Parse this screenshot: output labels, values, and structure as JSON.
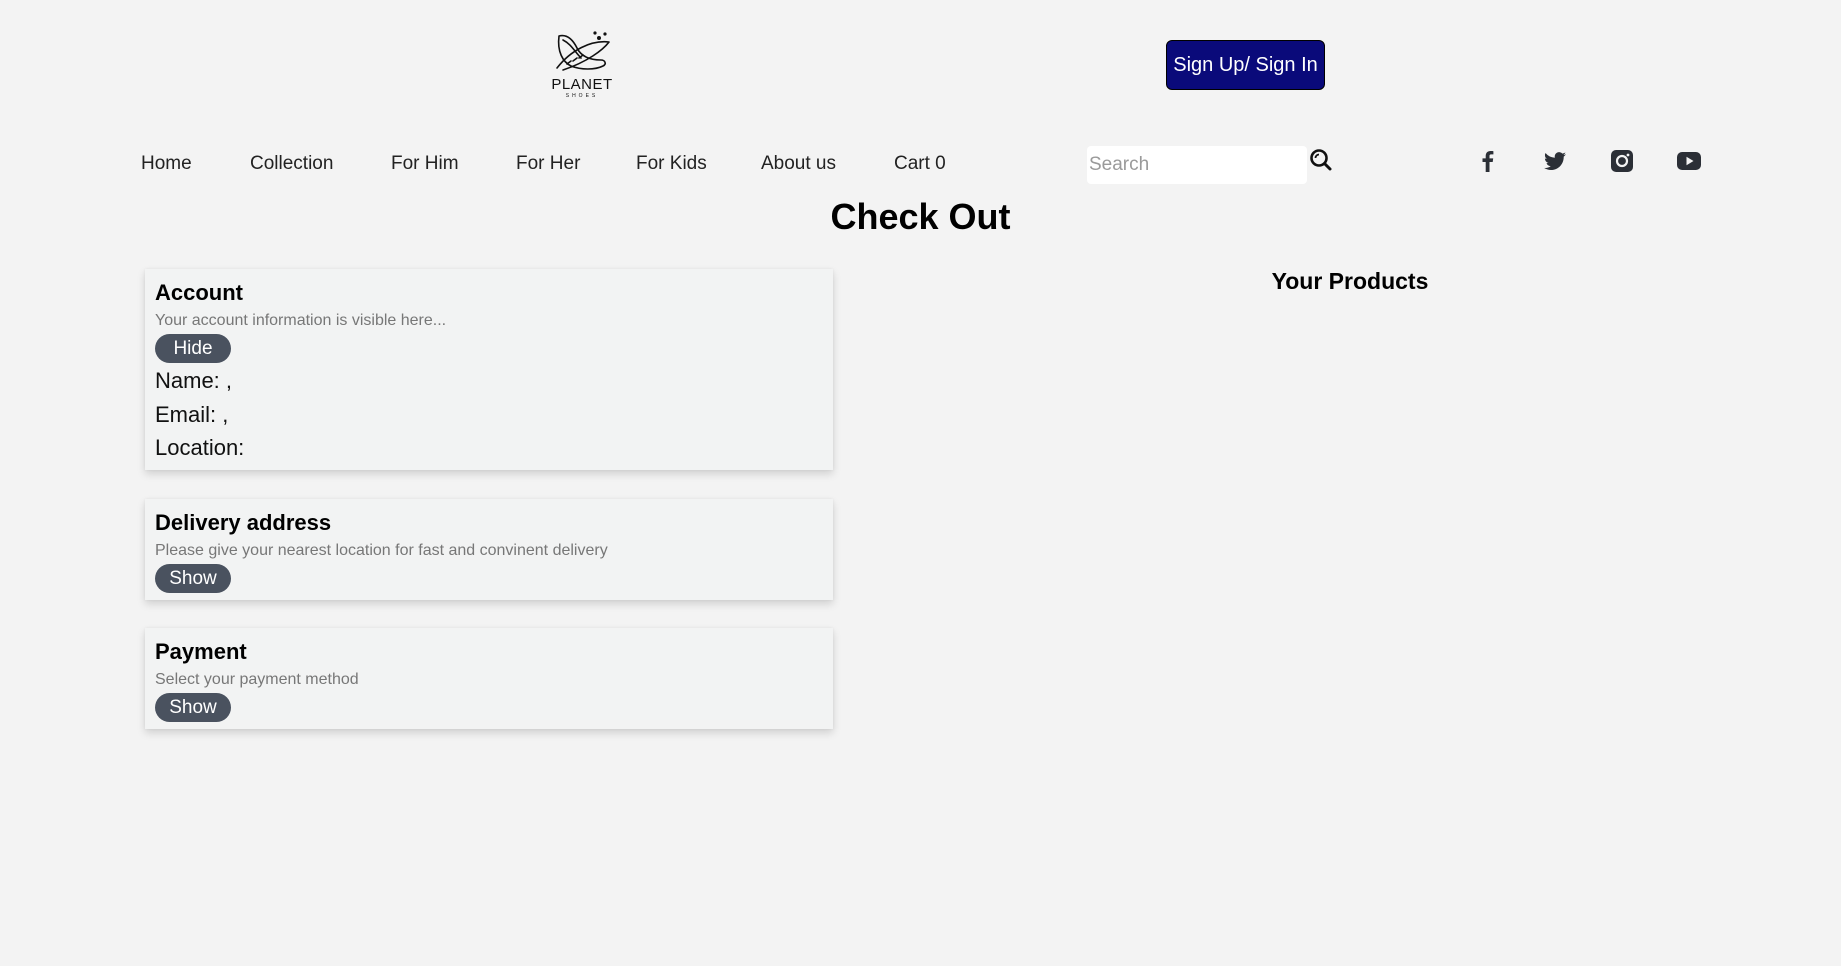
{
  "header": {
    "logo": {
      "name": "PLANET",
      "tagline": "SHOES"
    },
    "signin_label": "Sign Up/ Sign In"
  },
  "nav": {
    "items": [
      {
        "label": "Home"
      },
      {
        "label": "Collection"
      },
      {
        "label": "For Him"
      },
      {
        "label": "For Her"
      },
      {
        "label": "For Kids"
      },
      {
        "label": "About us"
      },
      {
        "label": "Cart 0"
      }
    ],
    "search_placeholder": "Search",
    "social_icons": [
      "facebook-icon",
      "twitter-icon",
      "instagram-icon",
      "youtube-icon"
    ]
  },
  "page_title": "Check Out",
  "account": {
    "title": "Account",
    "subtitle": "Your account information is visible here...",
    "toggle_label": "Hide",
    "name_line": "Name: ,",
    "email_line": "Email: ,",
    "location_line": "Location:"
  },
  "delivery": {
    "title": "Delivery address",
    "subtitle": "Please give your nearest location for fast and convinent delivery",
    "toggle_label": "Show"
  },
  "payment": {
    "title": "Payment",
    "subtitle": "Select your payment method",
    "toggle_label": "Show"
  },
  "products": {
    "title": "Your Products"
  },
  "colors": {
    "signin_bg": "#0a0a7a",
    "pill_bg": "#4a525f",
    "page_bg": "#f3f3f3"
  }
}
